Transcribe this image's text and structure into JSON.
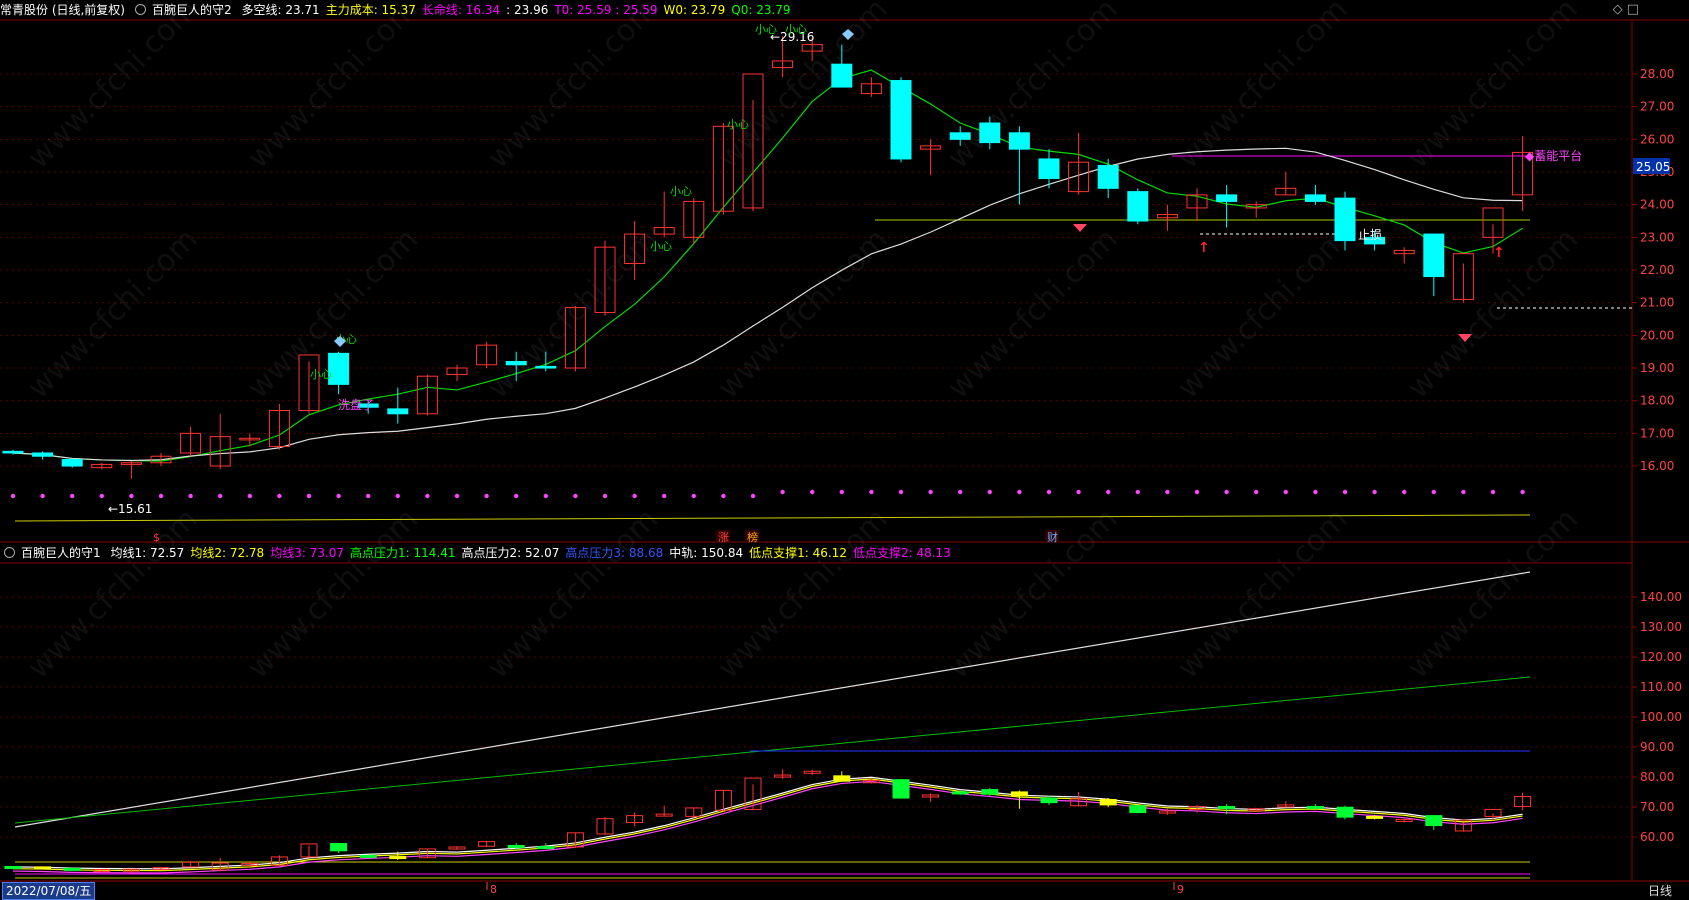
{
  "main_header": {
    "stock": "常青股份 (日线,前复权)",
    "indicator": "百腕巨人的守2",
    "items": [
      {
        "label": "多空线: 23.71",
        "color": "#ffffff"
      },
      {
        "label": "主力成本: 15.37",
        "color": "#ffff00"
      },
      {
        "label": "长命线: 16.34",
        "color": "#ff00ff"
      },
      {
        "label": ": 23.96",
        "color": "#ffffff"
      },
      {
        "label": "T0: 25.59 : 25.59",
        "color": "#ff00ff"
      },
      {
        "label": "W0: 23.79",
        "color": "#ffff00"
      },
      {
        "label": "Q0: 23.79",
        "color": "#00ff00"
      }
    ]
  },
  "sub_header": {
    "indicator": "百腕巨人的守1",
    "items": [
      {
        "label": "均线1: 72.57",
        "color": "#ffffff"
      },
      {
        "label": "均线2: 72.78",
        "color": "#ffff00"
      },
      {
        "label": "均线3: 73.07",
        "color": "#ff00ff"
      },
      {
        "label": "高点压力1: 114.41",
        "color": "#00ff00"
      },
      {
        "label": "高点压力2: 52.07",
        "color": "#ffffff"
      },
      {
        "label": "高点压力3: 88.68",
        "color": "#3355ff"
      },
      {
        "label": "中轨: 150.84",
        "color": "#ffffff"
      },
      {
        "label": "低点支撑1: 46.12",
        "color": "#ffff00"
      },
      {
        "label": "低点支撑2: 48.13",
        "color": "#ff00ff"
      }
    ]
  },
  "main_axis": [
    "28.00",
    "27.00",
    "26.00",
    "25.00",
    "24.00",
    "23.00",
    "22.00",
    "21.00",
    "20.00",
    "19.00",
    "18.00",
    "17.00",
    "16.00"
  ],
  "sub_axis": [
    "140.00",
    "130.00",
    "120.00",
    "110.00",
    "100.00",
    "90.00",
    "80.00",
    "70.00",
    "60.00"
  ],
  "price_tag": "25.05",
  "annotations": {
    "high": "29.16",
    "low": "15.61",
    "stop_loss": "止损",
    "platform": "蓄能平台",
    "wash": "洗盘了",
    "xin": "小心"
  },
  "event_markers": [
    {
      "text": "$",
      "color": "#ff3333"
    },
    {
      "text": "涨",
      "color": "#ff4444"
    },
    {
      "text": "榜",
      "color": "#ffaa00"
    },
    {
      "text": "财",
      "color": "#66aaff"
    }
  ],
  "month_labels": [
    "8",
    "9"
  ],
  "footer": {
    "date": "2022/07/08/五",
    "period": "日线"
  },
  "watermark": "www.cfchi.com",
  "candles": [
    [
      16.45,
      16.5,
      16.35,
      16.4
    ],
    [
      16.4,
      16.45,
      16.2,
      16.3
    ],
    [
      16.2,
      16.25,
      15.95,
      16.0
    ],
    [
      15.95,
      16.1,
      15.9,
      16.05
    ],
    [
      16.05,
      16.15,
      15.61,
      16.1
    ],
    [
      16.1,
      16.4,
      16.0,
      16.3
    ],
    [
      16.4,
      17.2,
      16.3,
      17.0
    ],
    [
      16.0,
      17.6,
      15.9,
      16.9
    ],
    [
      16.8,
      17.0,
      16.6,
      16.85
    ],
    [
      16.6,
      17.9,
      16.5,
      17.7
    ],
    [
      17.7,
      19.2,
      17.6,
      19.4
    ],
    [
      19.45,
      19.5,
      18.2,
      18.5
    ],
    [
      17.9,
      18.0,
      17.6,
      17.8
    ],
    [
      17.75,
      18.4,
      17.3,
      17.6
    ],
    [
      17.6,
      18.8,
      17.55,
      18.75
    ],
    [
      18.8,
      19.1,
      18.6,
      19.0
    ],
    [
      19.1,
      19.8,
      19.0,
      19.7
    ],
    [
      19.2,
      19.5,
      18.6,
      19.1
    ],
    [
      19.05,
      19.5,
      18.9,
      19.0
    ],
    [
      19.0,
      20.9,
      18.9,
      20.85
    ],
    [
      20.7,
      22.9,
      20.6,
      22.7
    ],
    [
      22.2,
      23.5,
      21.7,
      23.1
    ],
    [
      23.1,
      24.4,
      23.0,
      23.3
    ],
    [
      23.0,
      24.2,
      22.8,
      24.1
    ],
    [
      23.8,
      26.5,
      23.7,
      26.4
    ],
    [
      23.9,
      27.2,
      23.8,
      28.0
    ],
    [
      28.2,
      29.16,
      27.9,
      28.4
    ],
    [
      28.7,
      29.1,
      28.4,
      28.9
    ],
    [
      28.3,
      28.9,
      27.8,
      27.6
    ],
    [
      27.4,
      27.9,
      27.3,
      27.7
    ],
    [
      27.8,
      27.9,
      25.3,
      25.4
    ],
    [
      25.7,
      26.0,
      24.9,
      25.8
    ],
    [
      26.2,
      26.4,
      25.8,
      26.0
    ],
    [
      26.5,
      26.7,
      25.7,
      25.9
    ],
    [
      26.2,
      26.4,
      24.0,
      25.7
    ],
    [
      25.4,
      25.7,
      24.5,
      24.8
    ],
    [
      24.4,
      26.2,
      24.3,
      25.3
    ],
    [
      25.2,
      25.4,
      24.2,
      24.5
    ],
    [
      24.4,
      24.5,
      23.4,
      23.5
    ],
    [
      23.6,
      24.0,
      23.2,
      23.7
    ],
    [
      23.9,
      24.5,
      23.5,
      24.3
    ],
    [
      24.3,
      24.6,
      23.3,
      24.1
    ],
    [
      23.9,
      24.1,
      23.6,
      24.0
    ],
    [
      24.3,
      25.0,
      24.3,
      24.5
    ],
    [
      24.3,
      24.6,
      24.0,
      24.1
    ],
    [
      24.2,
      24.4,
      22.6,
      22.9
    ],
    [
      23.0,
      23.2,
      22.6,
      22.8
    ],
    [
      22.5,
      22.7,
      22.2,
      22.6
    ],
    [
      23.1,
      23.1,
      21.2,
      21.8
    ],
    [
      21.1,
      22.2,
      21.0,
      22.5
    ],
    [
      23.0,
      23.4,
      22.5,
      23.9
    ],
    [
      24.3,
      26.1,
      23.8,
      25.6
    ]
  ]
}
